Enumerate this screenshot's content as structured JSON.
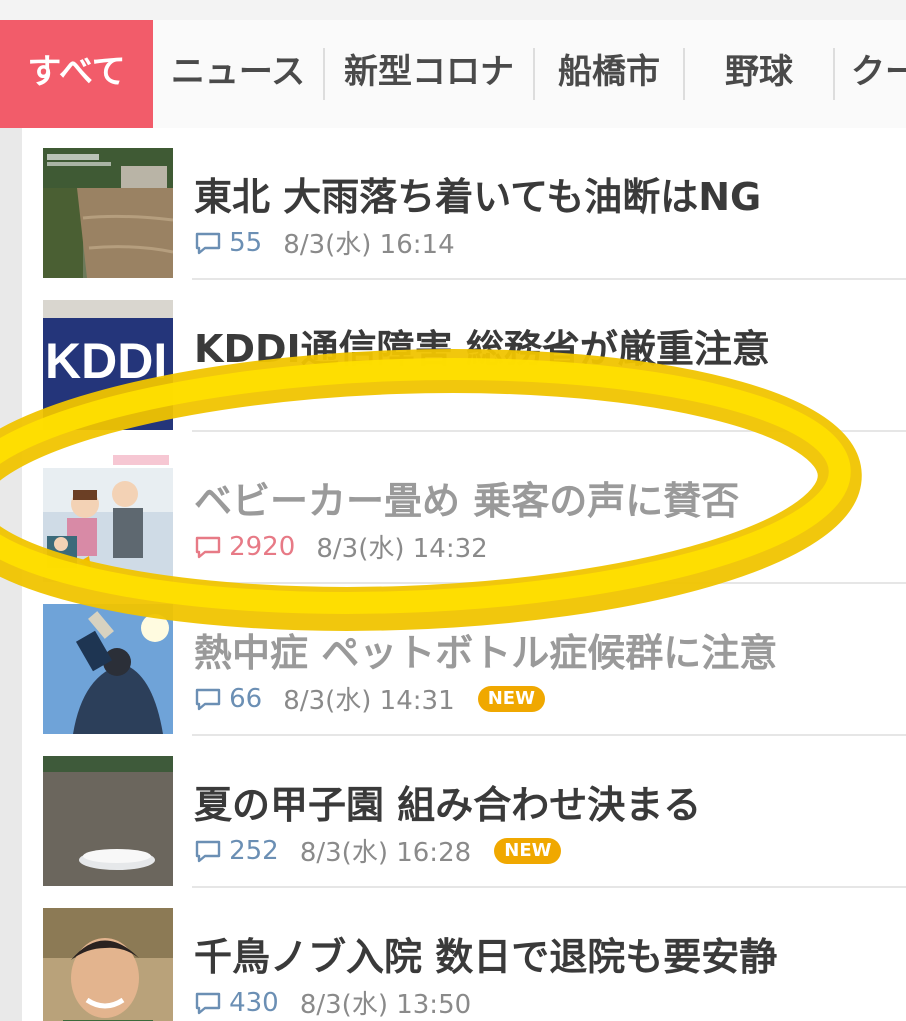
{
  "tabs": [
    {
      "label": "すべて",
      "active": true
    },
    {
      "label": "ニュース",
      "active": false
    },
    {
      "label": "新型コロナ",
      "active": false
    },
    {
      "label": "船橋市",
      "active": false
    },
    {
      "label": "野球",
      "active": false
    },
    {
      "label": "クー",
      "active": false
    }
  ],
  "articles": [
    {
      "title": "東北 大雨落ち着いても油断はNG",
      "comments": "55",
      "time": "8/3(水) 16:14",
      "is_new": false,
      "read": false,
      "hot": false,
      "thumb": "flood-photo"
    },
    {
      "title": "KDDI通信障害 総務省が厳重注意",
      "comments": "",
      "time": "",
      "is_new": false,
      "read": false,
      "hot": false,
      "thumb": "kddi-logo-photo"
    },
    {
      "title": "ベビーカー畳め 乗客の声に賛否",
      "comments": "2920",
      "time": "8/3(水) 14:32",
      "is_new": false,
      "read": true,
      "hot": true,
      "thumb": "stroller-illustration"
    },
    {
      "title": "熱中症 ペットボトル症候群に注意",
      "comments": "66",
      "time": "8/3(水) 14:31",
      "is_new": true,
      "read": true,
      "hot": false,
      "thumb": "drinking-bottle-photo"
    },
    {
      "title": "夏の甲子園 組み合わせ決まる",
      "comments": "252",
      "time": "8/3(水) 16:28",
      "is_new": true,
      "read": false,
      "hot": false,
      "thumb": "baseball-field-photo"
    },
    {
      "title": "千鳥ノブ入院 数日で退院も要安静",
      "comments": "430",
      "time": "8/3(水) 13:50",
      "is_new": false,
      "read": false,
      "hot": false,
      "thumb": "person-portrait-photo"
    }
  ],
  "new_badge_label": "NEW",
  "kddi_logo_text": "KDDI",
  "colors": {
    "accent": "#f25c6a",
    "comment_blue": "#6b8fb4",
    "comment_hot": "#e77a86",
    "new_badge": "#f0a800",
    "highlight": "#f7d400"
  }
}
